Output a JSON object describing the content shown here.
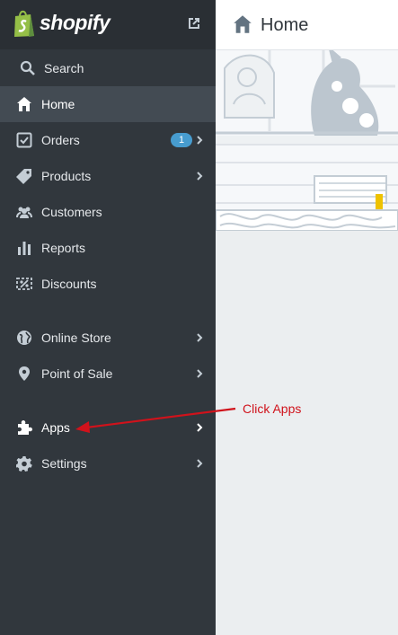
{
  "brand": {
    "name": "shopify"
  },
  "search": {
    "label": "Search"
  },
  "nav": {
    "home": "Home",
    "orders": "Orders",
    "orders_badge": "1",
    "products": "Products",
    "customers": "Customers",
    "reports": "Reports",
    "discounts": "Discounts",
    "online_store": "Online Store",
    "point_of_sale": "Point of Sale",
    "apps": "Apps",
    "settings": "Settings"
  },
  "header": {
    "title": "Home"
  },
  "annotation": {
    "text": "Click Apps",
    "color": "#d0121b"
  },
  "colors": {
    "sidebar": "#31373d",
    "active": "#434b53",
    "badge": "#479ccf",
    "logo_green": "#95bf47"
  },
  "icons": [
    "shopify-bag-icon",
    "external-link-icon",
    "search-icon",
    "home-icon",
    "orders-icon",
    "tag-icon",
    "customers-icon",
    "reports-icon",
    "discounts-icon",
    "globe-icon",
    "location-pin-icon",
    "puzzle-icon",
    "gear-icon",
    "chevron-right-icon"
  ]
}
